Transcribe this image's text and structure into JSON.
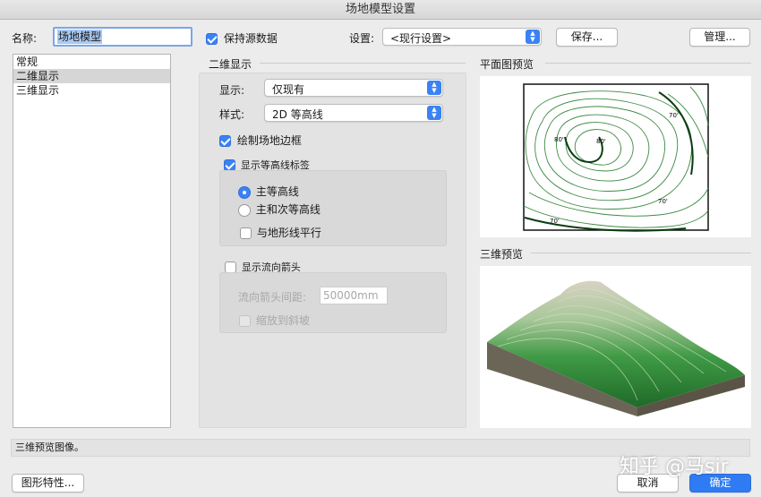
{
  "window": {
    "title": "场地模型设置"
  },
  "name_field": {
    "label": "名称:",
    "value": "场地模型"
  },
  "keep_source": {
    "label": "保持源数据",
    "checked": true
  },
  "settings": {
    "label": "设置:",
    "value": "<现行设置>",
    "save_label": "保存...",
    "manage_label": "管理..."
  },
  "sidebar": {
    "items": [
      {
        "label": "常规"
      },
      {
        "label": "二维显示"
      },
      {
        "label": "三维显示"
      }
    ]
  },
  "display2d": {
    "section_title": "二维显示",
    "display_label": "显示:",
    "display_value": "仅现有",
    "style_label": "样式:",
    "style_value": "2D 等高线",
    "draw_boundary_label": "绘制场地边框",
    "show_labels_label": "显示等高线标签",
    "major_label": "主等高线",
    "major_minor_label": "主和次等高线",
    "parallel_label": "与地形线平行",
    "show_arrows_label": "显示流向箭头",
    "arrow_spacing_label": "流向箭头间距:",
    "arrow_spacing_value": "50000mm",
    "scale_slope_label": "缩放到斜坡"
  },
  "plan_preview": {
    "title": "平面图预览",
    "labels": [
      "80'",
      "80'",
      "70'",
      "70'",
      "70'"
    ]
  },
  "preview3d": {
    "title": "三维预览"
  },
  "status": {
    "text": "三维预览图像。"
  },
  "footer": {
    "graphics_label": "图形特性...",
    "cancel_label": "取消",
    "ok_label": "确定"
  },
  "watermark": {
    "text": "知乎 @马sir"
  },
  "colors": {
    "accent": "#3b82f6",
    "terrain_green": "#2e8b3a",
    "terrain_side": "#6b6558"
  }
}
